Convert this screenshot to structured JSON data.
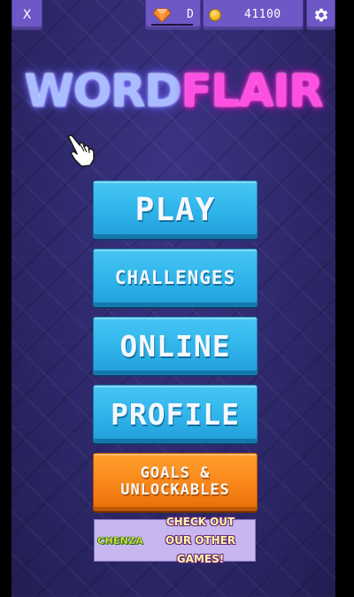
{
  "top_bar": {
    "close_label": "X",
    "gems_value": "D",
    "coins_value": "41100",
    "gem_icon": "gem-icon",
    "coin_icon": "coin-icon",
    "settings_icon": "gear-icon"
  },
  "logo": {
    "word_part": "WORD",
    "flair_part": "FLAIR",
    "word_color": "#a9bcff",
    "flair_color": "#ff4fe2"
  },
  "menu": {
    "play": "PLAY",
    "challenges": "CHALLENGES",
    "online": "ONLINE",
    "profile": "PROFILE",
    "goals_line1": "GOALS &",
    "goals_line2": "UNLOCKABLES"
  },
  "promo": {
    "brand": "CHENZA",
    "line1": "CHECK OUT",
    "line2": "OUR OTHER GAMES!"
  },
  "colors": {
    "button_blue": "#2eb3ea",
    "button_orange": "#f78418",
    "topbar_purple": "#6e58c6",
    "background": "#2f2a6c"
  }
}
